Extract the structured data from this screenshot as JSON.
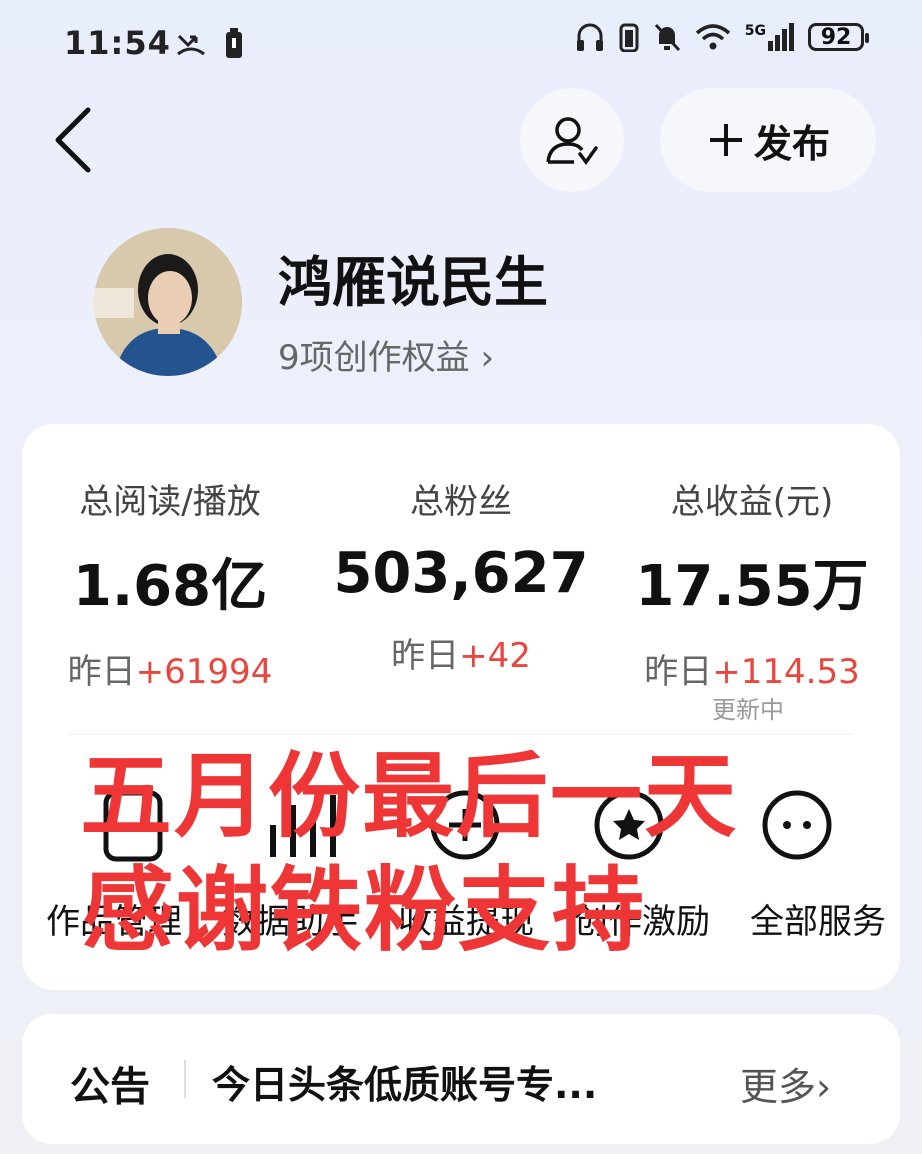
{
  "status_bar": {
    "time": "11:54",
    "network": "5G",
    "battery": "92"
  },
  "header": {
    "publish_label": "发布"
  },
  "profile": {
    "name": "鸿雁说民生",
    "benefits": "9项创作权益"
  },
  "stats": [
    {
      "label": "总阅读/播放",
      "value": "1.68亿",
      "delta_prefix": "昨日",
      "delta": "+61994"
    },
    {
      "label": "总粉丝",
      "value": "503,627",
      "delta_prefix": "昨日",
      "delta": "+42"
    },
    {
      "label": "总收益(元)",
      "value": "17.55万",
      "delta_prefix": "昨日",
      "delta": "+114.53"
    }
  ],
  "updating": "更新中",
  "services": [
    "作品管理",
    "数据助手",
    "收益提现",
    "创作激励",
    "全部服务"
  ],
  "overlay": {
    "line1": "五月份最后一天",
    "line2": "感谢铁粉支持"
  },
  "notice": {
    "title": "公告",
    "text": "今日头条低质账号专...",
    "more": "更多"
  }
}
